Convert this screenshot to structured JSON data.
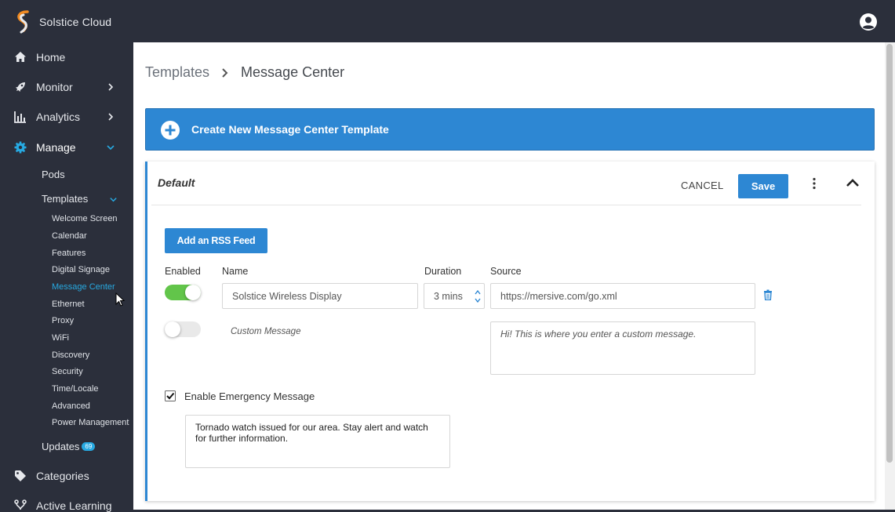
{
  "app": {
    "name": "Solstice Cloud"
  },
  "sidebar": {
    "items": [
      {
        "label": "Home",
        "icon": "home-icon"
      },
      {
        "label": "Monitor",
        "icon": "rocket-icon"
      },
      {
        "label": "Analytics",
        "icon": "bar-chart-icon"
      },
      {
        "label": "Manage",
        "icon": "gear-icon"
      },
      {
        "label": "Categories",
        "icon": "tag-icon"
      },
      {
        "label": "Active Learning",
        "icon": "branch-icon"
      }
    ],
    "manage": {
      "pods": "Pods",
      "templates": "Templates",
      "template_items": [
        "Welcome Screen",
        "Calendar",
        "Features",
        "Digital Signage",
        "Message Center",
        "Ethernet",
        "Proxy",
        "WiFi",
        "Discovery",
        "Security",
        "Time/Locale",
        "Advanced",
        "Power Management"
      ],
      "selected": "Message Center",
      "updates": "Updates",
      "updates_badge": "69"
    }
  },
  "breadcrumb": {
    "parent": "Templates",
    "current": "Message Center"
  },
  "create_bar": {
    "label": "Create New Message Center Template"
  },
  "template": {
    "title": "Default",
    "cancel_label": "CANCEL",
    "save_label": "Save",
    "rss_button": "Add an RSS Feed",
    "columns": {
      "enabled": "Enabled",
      "name": "Name",
      "duration": "Duration",
      "source": "Source"
    },
    "feed": {
      "enabled": true,
      "name": "Solstice Wireless Display",
      "duration": "3 mins",
      "source": "https://mersive.com/go.xml"
    },
    "custom": {
      "enabled": false,
      "label": "Custom Message",
      "text": "Hi! This is where you enter a custom message."
    },
    "emergency": {
      "checked": true,
      "label": "Enable Emergency Message",
      "text": "Tornado watch issued for our area. Stay alert and watch for further information."
    }
  },
  "colors": {
    "accent": "#2d87d3",
    "sidebar_bg": "#2b2f3b",
    "toggle_on": "#62c54a",
    "selected_nav": "#27a9e1"
  }
}
